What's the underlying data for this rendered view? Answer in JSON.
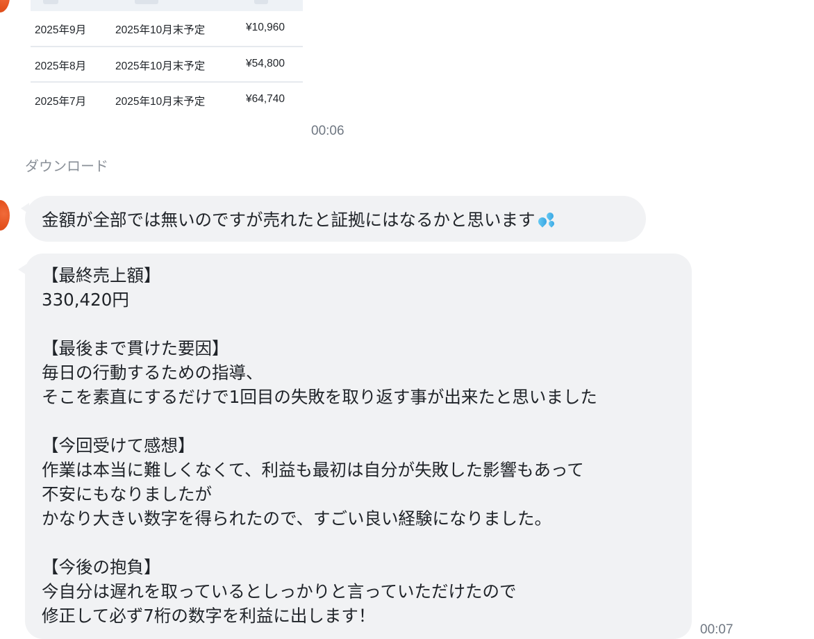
{
  "table": {
    "rows": [
      {
        "month": "2025年9月",
        "payout": "2025年10月末予定",
        "amount": "¥10,960"
      },
      {
        "month": "2025年8月",
        "payout": "2025年10月末予定",
        "amount": "¥54,800"
      },
      {
        "month": "2025年7月",
        "payout": "2025年10月末予定",
        "amount": "¥64,740"
      }
    ]
  },
  "messages": {
    "image_time": "00:06",
    "download_label": "ダウンロード",
    "msg1": {
      "text": "金額が全部では無いのですが売れたと証拠にはなるかと思います",
      "emoji": "sweat-droplets-icon"
    },
    "msg2": {
      "lines": [
        "【最終売上額】",
        "330,420円",
        "",
        "【最後まで貫けた要因】",
        "毎日の行動するための指導、",
        "そこを素直にするだけで1回目の失敗を取り返す事が出来たと思いました",
        "",
        "【今回受けて感想】",
        "作業は本当に難しくなくて、利益も最初は自分が失敗した影響もあって",
        "不安にもなりましたが",
        "かなり大きい数字を得られたので、すごい良い経験になりました。",
        "",
        "【今後の抱負】",
        "今自分は遅れを取っているとしっかりと言っていただけたので",
        "修正して必ず7桁の数字を利益に出します！"
      ],
      "time": "00:07"
    }
  },
  "colors": {
    "bubble_bg": "#f1f2f4",
    "avatar": "#e5531f",
    "timestamp": "#6f7782"
  }
}
